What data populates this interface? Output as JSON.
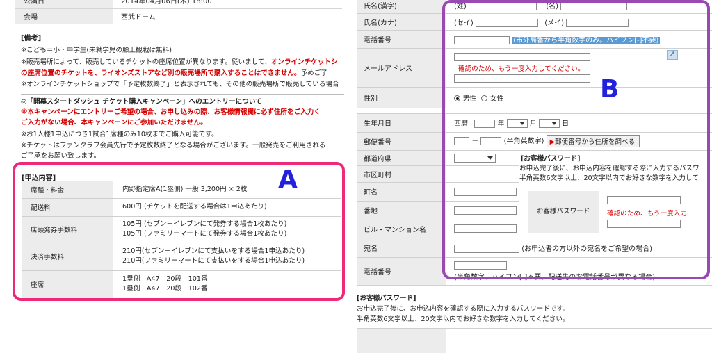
{
  "left": {
    "top_rows": [
      {
        "label": "公演日",
        "value": "2014年04月06日(木) 18:00"
      },
      {
        "label": "会場",
        "value": "西武ドーム"
      }
    ],
    "notes_heading": "[備考]",
    "notes": [
      {
        "text": "※こども＝小・中学生(未就学児の膝上観戦は無料)",
        "red": ""
      },
      {
        "text": "※販売場所によって、販売しているチケットの座席位置が異なります。従いまして、",
        "red": "オンラインチケットシ"
      },
      {
        "text": "",
        "red": "の座席位置のチケットを、ライオンズストアなど別の販売場所で購入することはできません。",
        "tail": "予めご了"
      },
      {
        "text": "※オンラインチケットショップで「予定枚数終了」と表示されても、その他の販売場所で販売している場合"
      }
    ],
    "campaign_heading": "◎「開幕スタートダッシュ チケット購入キャンペーン」へのエントリーについて",
    "campaign_red_1": "※本キャンペーンにエントリーご希望の場合、お申し込みの際、お客様情報欄に必ず住所をご入力く",
    "campaign_red_2": "ご入力がない場合、本キャンペーンにご参加いただけません。",
    "campaign_notes": [
      "※お1人様1申込につき1試合1席種のみ10枚までご購入可能です。",
      "※チケットはファンクラブ会員先行で予定枚数終了となる場合がございます。一般発売をご利用される",
      "ご了承をお願い致します。"
    ],
    "order_heading": "[申込内容]",
    "order_rows": [
      {
        "label": "席種・料金",
        "lines": [
          "内野指定席A(1塁側) 一般 3,200円 × 2枚"
        ]
      },
      {
        "label": "配送料",
        "lines": [
          "600円 (チケットを配送する場合は1申込あたり)"
        ]
      },
      {
        "label": "店頭発券手数料",
        "lines": [
          "105円 (セブン－イレブンにて発券する場合1枚あたり)",
          "105円 (ファミリーマートにて発券する場合1枚あたり)"
        ]
      },
      {
        "label": "決済手数料",
        "lines": [
          "210円(セブン－イレブンにて支払いをする場合1申込あたり)",
          "210円(ファミリーマートにて支払いをする場合1申込あたり)"
        ]
      },
      {
        "label": "座席",
        "lines": [
          "1塁側　A47　20段　101番",
          "1塁側　A47　20段　102番"
        ]
      }
    ],
    "marker": "A"
  },
  "right": {
    "name_kanji": {
      "label": "氏名(漢字)",
      "sei": "(姓)",
      "mei": "(名)"
    },
    "name_kana": {
      "label": "氏名(カナ)",
      "sei": "(セイ)",
      "mei": "(メイ)"
    },
    "phone": {
      "label": "電話番号",
      "hint": "(市外局番から半角数字のみ。ハイフン[-]不要)"
    },
    "email": {
      "label": "メールアドレス",
      "confirm_note": "確認のため、もう一度入力してください。"
    },
    "gender": {
      "label": "性別",
      "male": "男性",
      "female": "女性",
      "selected": "male"
    },
    "birthday": {
      "label": "生年月日",
      "era": "西暦",
      "year": "年",
      "month": "月",
      "day": "日"
    },
    "postal": {
      "label": "郵便番号",
      "dash": "－",
      "hint": "(半角英数字)",
      "lookup_button": "郵便番号から住所を調べる"
    },
    "prefecture": {
      "label": "都道府県"
    },
    "city": {
      "label": "市区町村"
    },
    "town": {
      "label": "町名"
    },
    "street": {
      "label": "番地"
    },
    "building": {
      "label": "ビル・マンション名"
    },
    "addressee": {
      "label": "宛名",
      "hint": "(お申込者の方以外の宛名をご希望の場合)"
    },
    "phone2": {
      "label": "電話番号",
      "hint": "(半角数字、ハイフン[-]不要。配送先のお電話番号が異なる場合)"
    },
    "password_popup": {
      "heading": "[お客様パスワード]",
      "line1": "お申込完了後に、お申込内容を確認する際に入力するパスワ",
      "line2": "半角英数6文字以上、20文字以内でお好きな数字を入力して",
      "label": "お客様パスワード",
      "confirm_note": "確認のため、もう一度入力"
    },
    "password_section": {
      "heading": "[お客様パスワード]",
      "line1": "お申込完了後に、お申込内容を確認する際に入力するパスワードです。",
      "line2": "半角英数6文字以上、20文字以内でお好きな数字を入力してください。"
    },
    "marker": "B"
  },
  "colors": {
    "frame_a": "#ee2a78",
    "frame_b": "#9a48b3",
    "marker": "#2222dd",
    "warning_red": "#d40000",
    "hint_highlight": "#5a9bd6"
  },
  "icons": [
    "expand-icon",
    "triangle-right-icon",
    "dropdown-arrow-icon"
  ]
}
